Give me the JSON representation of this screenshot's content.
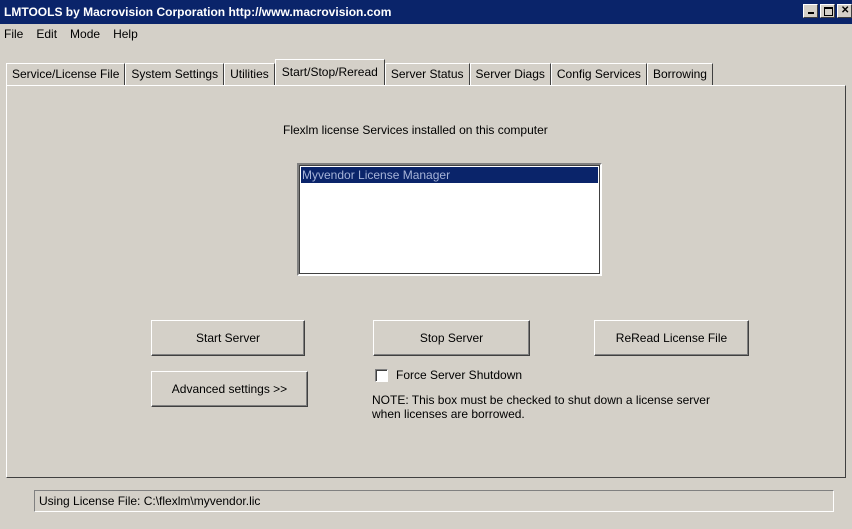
{
  "window": {
    "title": "LMTOOLS by Macrovision Corporation http://www.macrovision.com"
  },
  "menu": [
    "File",
    "Edit",
    "Mode",
    "Help"
  ],
  "tabs": [
    {
      "label": "Service/License File"
    },
    {
      "label": "System Settings"
    },
    {
      "label": "Utilities"
    },
    {
      "label": "Start/Stop/Reread",
      "active": true
    },
    {
      "label": "Server Status"
    },
    {
      "label": "Server Diags"
    },
    {
      "label": "Config Services"
    },
    {
      "label": "Borrowing"
    }
  ],
  "panel": {
    "caption": "Flexlm license Services installed on this computer",
    "services": [
      "Myvendor License Manager"
    ],
    "buttons": {
      "start": "Start Server",
      "stop": "Stop Server",
      "reread": "ReRead License File",
      "advanced": "Advanced settings >>"
    },
    "force_shutdown": {
      "label": "Force Server Shutdown",
      "checked": false
    },
    "note_line1": "NOTE:  This box must be checked to shut down a license server",
    "note_line2": "when licenses are borrowed."
  },
  "status": {
    "text": "Using License File:  C:\\flexlm\\myvendor.lic"
  },
  "colors": {
    "titlebar": "#0a246a",
    "face": "#d4d0c8",
    "selection": "#0a246a"
  }
}
